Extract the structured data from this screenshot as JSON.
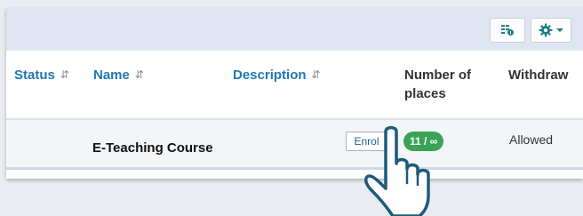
{
  "toolbar": {
    "columns_icon": "columns-info-icon",
    "settings_icon": "gear-icon",
    "settings_caret": "caret-down-icon"
  },
  "table": {
    "headers": {
      "status": "Status",
      "name": "Name",
      "description": "Description",
      "places": "Number of places",
      "withdraw": "Withdraw"
    },
    "rows": [
      {
        "status": "",
        "name": "E-Teaching Course",
        "enrol_label": "Enrol",
        "places": "11 / ∞",
        "withdraw": "Allowed"
      }
    ]
  },
  "colors": {
    "link": "#1f78b4",
    "badge": "#3aa357",
    "toolbar": "#dfe6f1",
    "icon": "#1a7f86"
  },
  "cursor": "hand-pointer-icon"
}
